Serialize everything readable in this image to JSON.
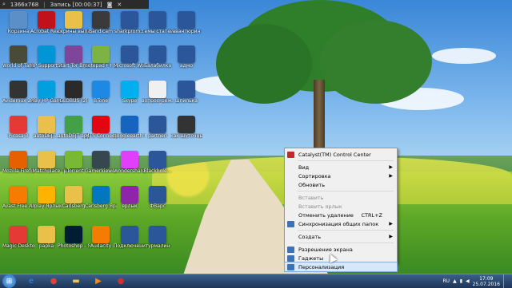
{
  "recorder": {
    "resolution": "1366x768",
    "status": "Запись [00:00:37]"
  },
  "desktop_icons": [
    {
      "label": "Корзина",
      "icon": "recycle-bin-icon",
      "color": "#5b8fc7"
    },
    {
      "label": "Acrobat Reader DC",
      "icon": "acrobat-icon",
      "color": "#c1121c"
    },
    {
      "label": "скрины выпал",
      "icon": "folder-icon",
      "color": "#e8c04a"
    },
    {
      "label": "Bandicam",
      "icon": "bandicam-icon",
      "color": "#3a3a3a"
    },
    {
      "label": "sharkprom...",
      "icon": "word-doc-icon",
      "color": "#2b579a"
    },
    {
      "label": "темы статей",
      "icon": "word-doc-icon",
      "color": "#2b579a"
    },
    {
      "label": "авантюрин",
      "icon": "word-doc-icon",
      "color": "#2b579a"
    },
    {
      "label": "World of Tanks",
      "icon": "tanks-icon",
      "color": "#4a4a3a"
    },
    {
      "label": "HP Support Assistant",
      "icon": "hp-icon",
      "color": "#0096d6"
    },
    {
      "label": "Start Tor Browser",
      "icon": "tor-icon",
      "color": "#7d4698"
    },
    {
      "label": "notepad++ Ярлык",
      "icon": "notepad-icon",
      "color": "#7cb342"
    },
    {
      "label": "Microsoft Word 2010",
      "icon": "word-icon",
      "color": "#2b579a"
    },
    {
      "label": "Балабилка",
      "icon": "word-doc-icon",
      "color": "#2b579a"
    },
    {
      "label": "адмо",
      "icon": "word-doc-icon",
      "color": "#2b579a"
    },
    {
      "label": "Avidemux 2.6 - 64 bits",
      "icon": "avidemux-icon",
      "color": "#333333"
    },
    {
      "label": "Play HP Games",
      "icon": "hp-games-icon",
      "color": "#00a0e0"
    },
    {
      "label": "GLOBUS (2)",
      "icon": "globus-icon",
      "color": "#2a2a2a"
    },
    {
      "label": "BTone",
      "icon": "btone-icon",
      "color": "#1e88e5"
    },
    {
      "label": "Skype",
      "icon": "skype-icon",
      "color": "#00aff0"
    },
    {
      "label": "вопрос_реж...",
      "icon": "word-a-icon",
      "color": "#f0f0f0"
    },
    {
      "label": "шпилька",
      "icon": "word-doc-icon",
      "color": "#2b579a"
    },
    {
      "label": "Picasa 3",
      "icon": "picasa-icon",
      "color": "#e53935"
    },
    {
      "label": "autoDEJT...",
      "icon": "folder-icon",
      "color": "#e8c04a"
    },
    {
      "label": "autoDEJT app",
      "icon": "autodesk-icon",
      "color": "#43a047"
    },
    {
      "label": "MTS Connect",
      "icon": "mts-icon",
      "color": "#e30611"
    },
    {
      "label": "googleearth Ярлык",
      "icon": "google-earth-icon",
      "color": "#1565c0"
    },
    {
      "label": "partneri",
      "icon": "word-doc-icon",
      "color": "#2b579a"
    },
    {
      "label": "как шуточные...",
      "icon": "video-icon",
      "color": "#333333"
    },
    {
      "label": "Mozilla Firefox",
      "icon": "firefox-icon",
      "color": "#e66000"
    },
    {
      "label": "Matchplace",
      "icon": "folder-icon",
      "color": "#e8c04a"
    },
    {
      "label": "µTorrent",
      "icon": "utorrent-icon",
      "color": "#78b832"
    },
    {
      "label": "Gamerkiewer",
      "icon": "calculator-icon",
      "color": "#37474f"
    },
    {
      "label": "Wondershare Ярлык",
      "icon": "wondershare-icon",
      "color": "#e040fb"
    },
    {
      "label": "Blackhole...",
      "icon": "word-doc-icon",
      "color": "#2b579a"
    },
    {
      "label": "Avast Free Antivirus",
      "icon": "avast-icon",
      "color": "#f57c00"
    },
    {
      "label": "Uplay Ярлык",
      "icon": "uplay-icon",
      "color": "#ffb300"
    },
    {
      "label": "Carlsberg",
      "icon": "folder-icon",
      "color": "#e8c04a"
    },
    {
      "label": "Carlsberg Ярлык",
      "icon": "carlsberg-icon",
      "color": "#0277bd"
    },
    {
      "label": "ярлык",
      "icon": "archive-icon",
      "color": "#8e24aa"
    },
    {
      "label": "ФВарс",
      "icon": "word-doc-icon",
      "color": "#2b579a"
    },
    {
      "label": "Magic Desktop",
      "icon": "magic-desktop-icon",
      "color": "#e53935"
    },
    {
      "label": "papka",
      "icon": "folder-icon",
      "color": "#e8c04a"
    },
    {
      "label": "Photoshop - Ярлык",
      "icon": "photoshop-icon",
      "color": "#001d34"
    },
    {
      "label": "Audacity",
      "icon": "audacity-icon",
      "color": "#f57c00"
    },
    {
      "label": "Подключение к сети",
      "icon": "word-doc-icon",
      "color": "#2b579a"
    },
    {
      "label": "турмалин",
      "icon": "word-doc-icon",
      "color": "#2b579a"
    }
  ],
  "context_menu": {
    "items": [
      {
        "label": "Catalyst(TM) Control Center",
        "icon": "catalyst-icon",
        "type": "item"
      },
      {
        "type": "separator"
      },
      {
        "label": "Вид",
        "type": "submenu"
      },
      {
        "label": "Сортировка",
        "type": "submenu"
      },
      {
        "label": "Обновить",
        "type": "item"
      },
      {
        "type": "separator"
      },
      {
        "label": "Вставить",
        "type": "disabled"
      },
      {
        "label": "Вставить ярлык",
        "type": "disabled"
      },
      {
        "label": "Отменить удаление",
        "shortcut": "CTRL+Z",
        "type": "item"
      },
      {
        "label": "Синхронизация общих папок",
        "icon": "sync-icon",
        "type": "submenu"
      },
      {
        "type": "separator"
      },
      {
        "label": "Создать",
        "type": "submenu"
      },
      {
        "type": "separator"
      },
      {
        "label": "Разрешение экрана",
        "icon": "display-icon",
        "type": "item"
      },
      {
        "label": "Гаджеты",
        "icon": "gadgets-icon",
        "type": "item"
      },
      {
        "label": "Персонализация",
        "icon": "personalize-icon",
        "type": "highlighted"
      }
    ]
  },
  "taskbar": {
    "apps": [
      {
        "name": "internet-explorer-icon",
        "glyph": "e",
        "color": "#1e90ff"
      },
      {
        "name": "chrome-icon",
        "glyph": "●",
        "color": "#db4437"
      },
      {
        "name": "explorer-folder-icon",
        "glyph": "▬",
        "color": "#f2c14e"
      },
      {
        "name": "media-player-icon",
        "glyph": "▶",
        "color": "#ff8c00"
      },
      {
        "name": "bandicam-rec-icon",
        "glyph": "●",
        "color": "#d32f2f"
      }
    ],
    "language": "RU",
    "time": "17:09",
    "date": "25.07.2016"
  }
}
